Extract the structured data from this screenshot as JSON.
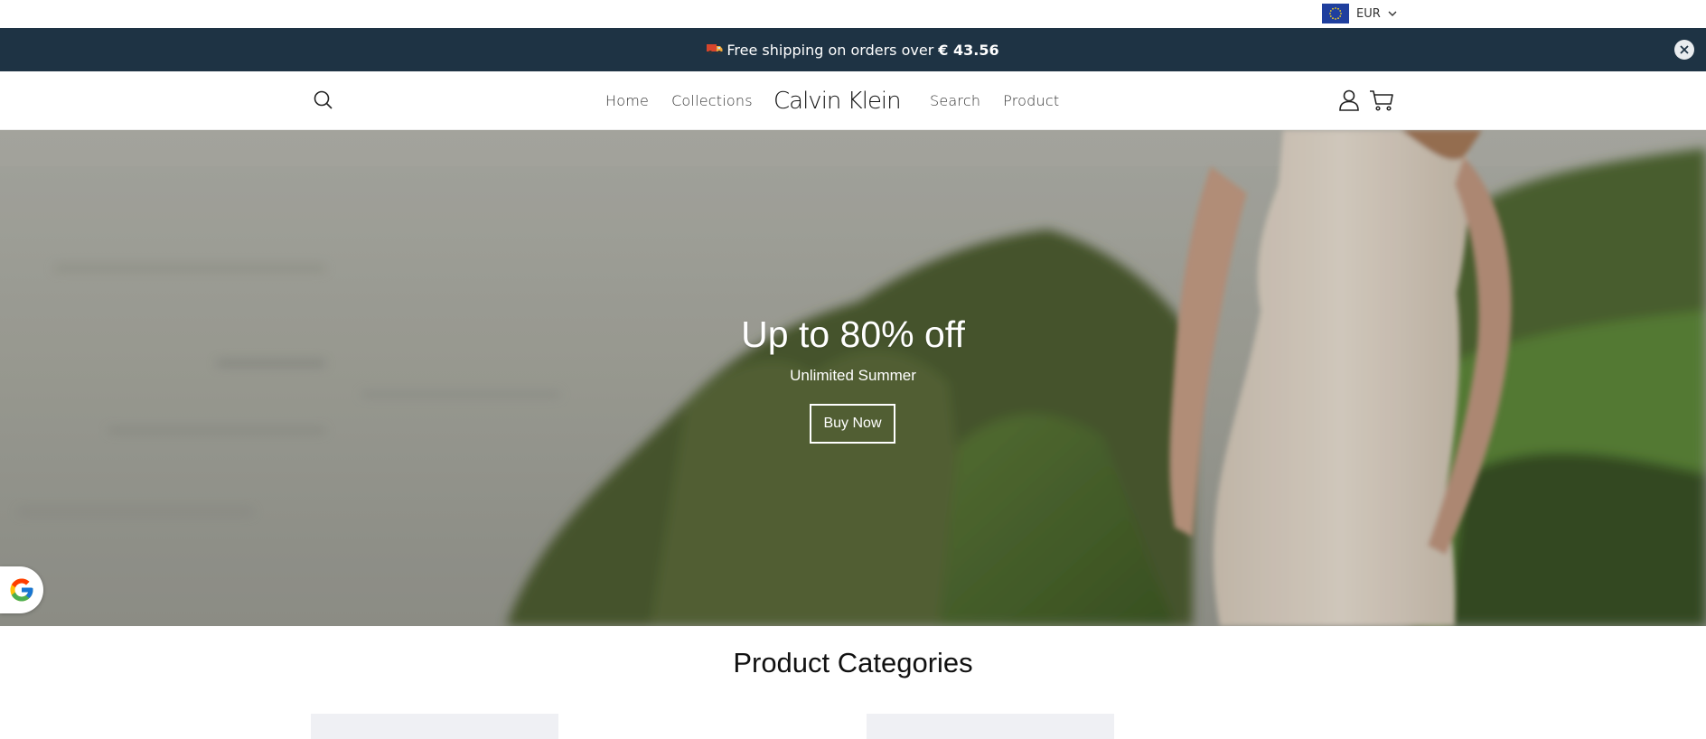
{
  "currency": {
    "code": "EUR",
    "flag": "eu-flag-icon"
  },
  "announcement": {
    "text": "Free shipping on orders over",
    "amount": "€ 43.56",
    "background": "#1e3344"
  },
  "header": {
    "nav_left": [
      {
        "label": "Home"
      },
      {
        "label": "Collections"
      }
    ],
    "logo": "Calvin Klein",
    "nav_right": [
      {
        "label": "Search"
      },
      {
        "label": "Product"
      }
    ]
  },
  "hero": {
    "title": "Up to 80% off",
    "subtitle": "Unlimited Summer",
    "button_label": "Buy Now"
  },
  "categories": {
    "title": "Product Categories"
  }
}
